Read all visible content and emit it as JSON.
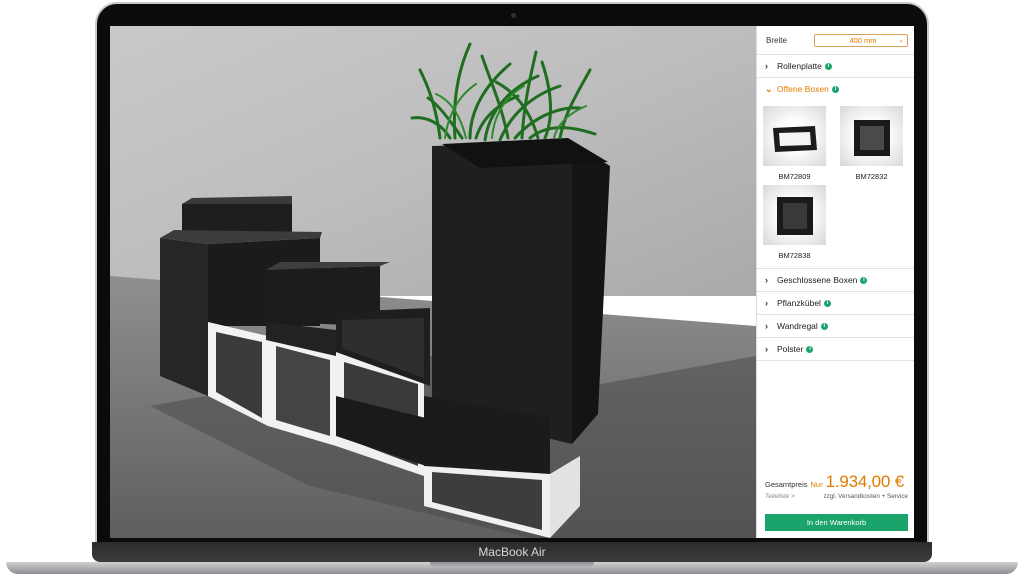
{
  "device": {
    "name": "MacBook Air"
  },
  "configurator": {
    "width_label": "Breite",
    "width_value": "400 mm",
    "sections": [
      {
        "label": "Rollenplatte",
        "open": false
      },
      {
        "label": "Offene Boxen",
        "open": true
      },
      {
        "label": "Geschlossene Boxen",
        "open": false
      },
      {
        "label": "Pflanzkübel",
        "open": false
      },
      {
        "label": "Wandregal",
        "open": false
      },
      {
        "label": "Polster",
        "open": false
      }
    ],
    "products": [
      {
        "code": "BM72809",
        "shape": "wide-box"
      },
      {
        "code": "BM72832",
        "shape": "square-box"
      },
      {
        "code": "BM72838",
        "shape": "cube-box"
      }
    ],
    "total": {
      "label": "Gesamtpreis",
      "prefix": "Nur",
      "price": "1.934,00 €",
      "parts_link": "Teileliste >",
      "shipping_note": "zzgl. Versandkosten + Service"
    },
    "cart_button": "In den Warenkorb"
  },
  "icons": {
    "collapsed": "chevron-right-icon",
    "expanded": "chevron-down-icon",
    "info": "info-icon"
  },
  "colors": {
    "accent": "#e07b00",
    "button": "#1aa36b",
    "info": "#1aa36b"
  }
}
